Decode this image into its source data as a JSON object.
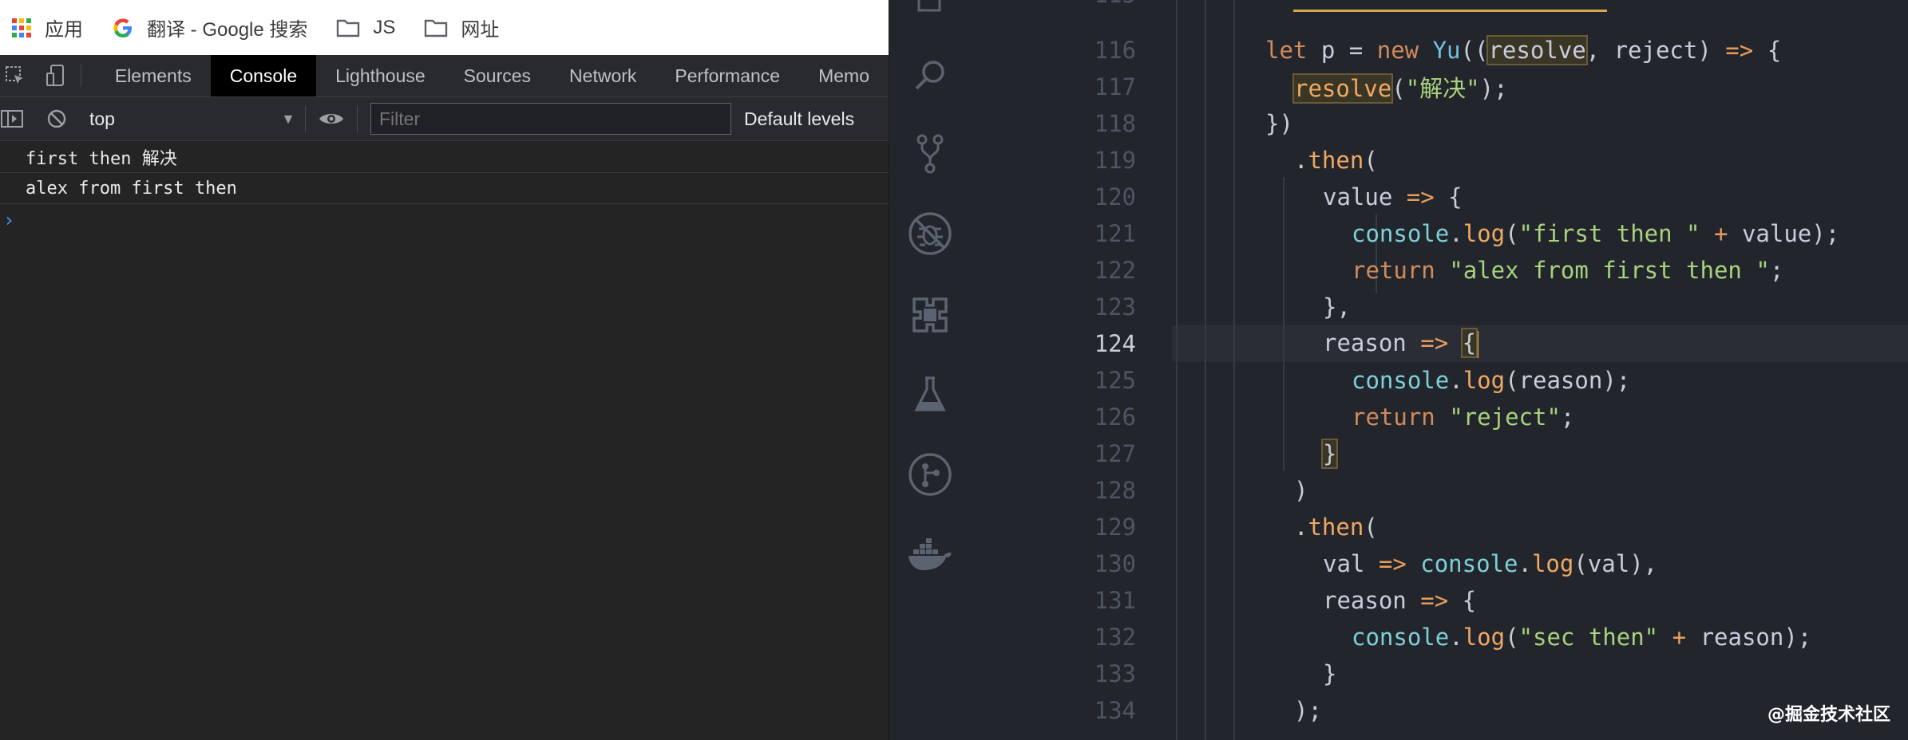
{
  "bookmarks": {
    "items": [
      {
        "label": "应用",
        "icon": "apps-grid-icon"
      },
      {
        "label": "翻译 - Google 搜索",
        "icon": "google-icon"
      },
      {
        "label": "JS",
        "icon": "folder-icon"
      },
      {
        "label": "网址",
        "icon": "folder-icon"
      }
    ]
  },
  "devtools": {
    "tabs": [
      "Elements",
      "Console",
      "Lighthouse",
      "Sources",
      "Network",
      "Performance",
      "Memo"
    ],
    "active_tab": "Console",
    "console": {
      "context": "top",
      "filter_placeholder": "Filter",
      "levels": "Default levels",
      "logs": [
        "first then 解决",
        "alex from first then"
      ]
    }
  },
  "editor": {
    "active_line": 124,
    "line_numbers": [
      "116",
      "117",
      "118",
      "119",
      "120",
      "121",
      "122",
      "123",
      "124",
      "125",
      "126",
      "127",
      "128",
      "129",
      "130",
      "131",
      "132",
      "133",
      "134"
    ]
  },
  "watermark": "@掘金技术社区",
  "colors": {
    "devtools_bg": "#242424",
    "editor_bg": "#22252c",
    "string": "#a9d27c",
    "keyword": "#e5a16b",
    "accent_blue": "#4c8df6"
  }
}
